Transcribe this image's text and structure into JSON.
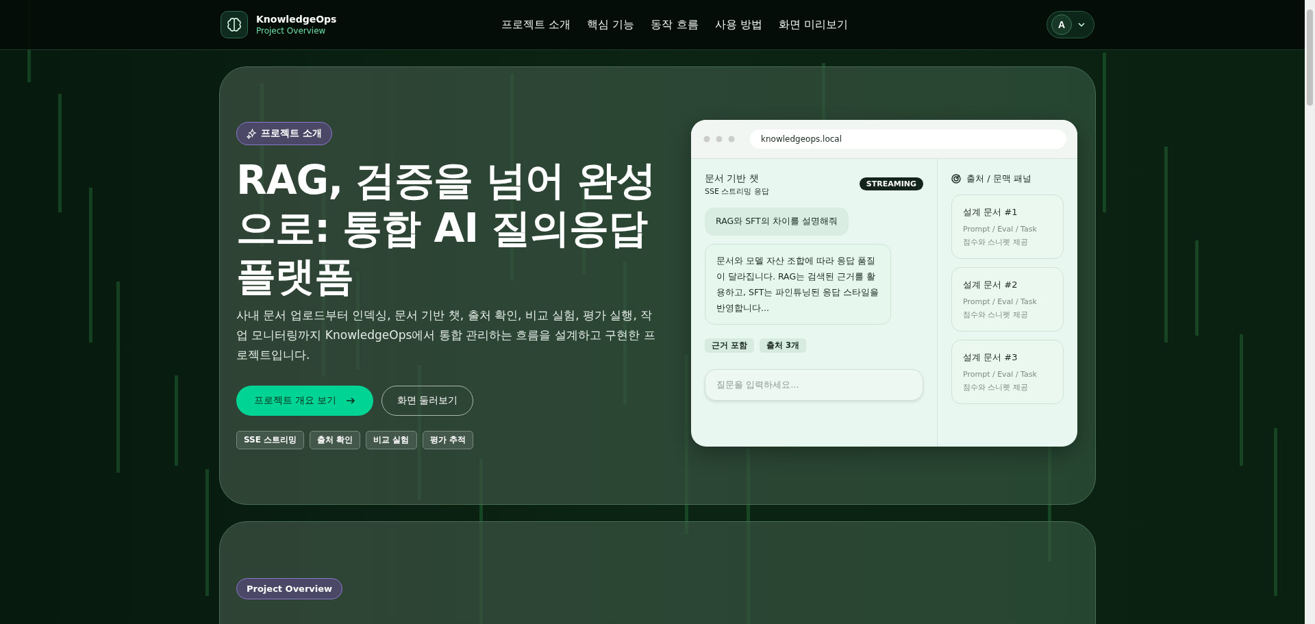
{
  "header": {
    "brand": {
      "name": "KnowledgeOps",
      "subtitle": "Project Overview"
    },
    "nav": [
      {
        "label": "프로젝트 소개"
      },
      {
        "label": "핵심 기능"
      },
      {
        "label": "동작 흐름"
      },
      {
        "label": "사용 방법"
      },
      {
        "label": "화면 미리보기"
      }
    ],
    "account": {
      "initial": "A"
    }
  },
  "hero": {
    "badge": "프로젝트 소개",
    "title": "RAG, 검증을 넘어 완성으로: 통합 AI 질의응답 플랫폼",
    "description": "사내 문서 업로드부터 인덱싱, 문서 기반 챗, 출처 확인, 비교 실험, 평가 실행, 작업 모니터링까지 KnowledgeOps에서 통합 관리하는 흐름을 설계하고 구현한 프로젝트입니다.",
    "buttons": [
      {
        "label": "프로젝트 개요 보기",
        "kind": "primary"
      },
      {
        "label": "화면 둘러보기",
        "kind": "secondary"
      }
    ],
    "tags": [
      "SSE 스트리밍",
      "출처 확인",
      "비교 실험",
      "평가 추적"
    ]
  },
  "preview": {
    "url": "knowledgeops.local",
    "chat": {
      "title": "문서 기반 챗",
      "subtitle": "SSE 스트리밍 응답",
      "status": "STREAMING",
      "messages": [
        {
          "kind": "question",
          "text": "RAG와 SFT의 차이를 설명해줘"
        },
        {
          "kind": "answer",
          "text": "문서와 모델 자산 조합에 따라 응답 품질이 달라집니다. RAG는 검색된 근거를 활용하고, SFT는 파인튜닝된 응답 스타일을 반영합니다..."
        }
      ],
      "chips": [
        "근거 포함",
        "출처 3개"
      ],
      "input": {
        "placeholder": "질문을 입력하세요..."
      }
    },
    "panel": {
      "title": "출처 / 문맥 패널",
      "cards": [
        {
          "title": "설계 문서 #1",
          "meta": "Prompt / Eval / Task",
          "note": "점수와 스니펫 제공"
        },
        {
          "title": "설계 문서 #2",
          "meta": "Prompt / Eval / Task",
          "note": "점수와 스니펫 제공"
        },
        {
          "title": "설계 문서 #3",
          "meta": "Prompt / Eval / Task",
          "note": "점수와 스니펫 제공"
        }
      ]
    }
  },
  "next_section": {
    "badge": "Project Overview"
  }
}
